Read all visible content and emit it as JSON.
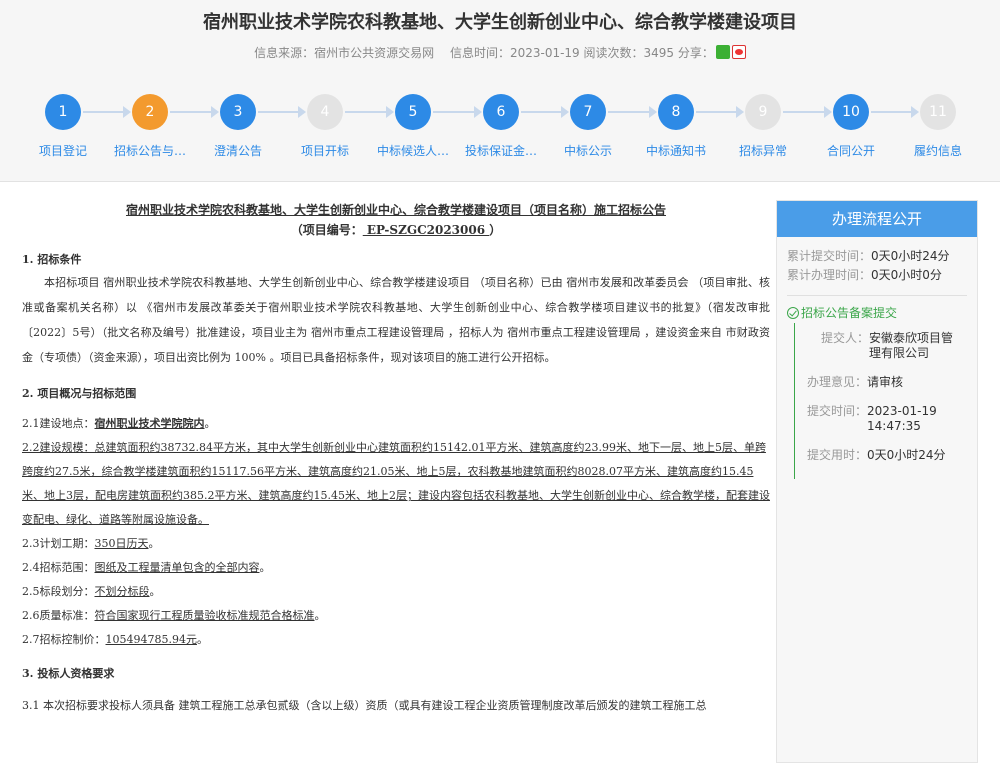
{
  "page": {
    "title": "宿州职业技术学院农科教基地、大学生创新创业中心、综合教学楼建设项目",
    "source_label": "信息来源：宿州市公共资源交易网",
    "time_label": "信息时间：2023-01-19 阅读次数：3495 分享："
  },
  "steps": [
    {
      "num": "1",
      "label": "项目登记",
      "state": "done"
    },
    {
      "num": "2",
      "label": "招标公告与…",
      "state": "current"
    },
    {
      "num": "3",
      "label": "澄清公告",
      "state": "done"
    },
    {
      "num": "4",
      "label": "项目开标",
      "state": "pending"
    },
    {
      "num": "5",
      "label": "中标候选人…",
      "state": "done"
    },
    {
      "num": "6",
      "label": "投标保证金…",
      "state": "done"
    },
    {
      "num": "7",
      "label": "中标公示",
      "state": "done"
    },
    {
      "num": "8",
      "label": "中标通知书",
      "state": "done"
    },
    {
      "num": "9",
      "label": "招标异常",
      "state": "pending"
    },
    {
      "num": "10",
      "label": "合同公开",
      "state": "done"
    },
    {
      "num": "11",
      "label": "履约信息",
      "state": "pending"
    }
  ],
  "doc": {
    "title_line1": "宿州职业技术学院农科教基地、大学生创新创业中心、综合教学楼建设项目（项目名称）施工招标公告",
    "title_line2_prefix": "（项目编号：",
    "title_line2_code": "    EP-SZGC2023006 ",
    "title_line2_suffix": "）",
    "sec1": "1. 招标条件",
    "sec1_para": "本招标项目 宿州职业技术学院农科教基地、大学生创新创业中心、综合教学楼建设项目 （项目名称）已由 宿州市发展和改革委员会 （项目审批、核准或备案机关名称）以 《宿州市发展改革委关于宿州职业技术学院农科教基地、大学生创新创业中心、综合教学楼项目建议书的批复》（宿发改审批〔2022〕5号）（批文名称及编号）批准建设，项目业主为 宿州市重点工程建设管理局 ，招标人为 宿州市重点工程建设管理局 ，建设资金来自 市财政资金（专项债）（资金来源），项目出资比例为 100% 。项目已具备招标条件，现对该项目的施工进行公开招标。",
    "sec2": "2. 项目概况与招标范围",
    "l21_prefix": "2.1建设地点：",
    "l21_value": "宿州职业技术学院院内",
    "l22": "2.2建设规模：总建筑面积约38732.84平方米，其中大学生创新创业中心建筑面积约15142.01平方米、建筑高度约23.99米、地下一层、地上5层、单跨跨度约27.5米，综合教学楼建筑面积约15117.56平方米、建筑高度约21.05米、地上5层，农科教基地建筑面积约8028.07平方米、建筑高度约15.45米、地上3层，配电房建筑面积约385.2平方米、建筑高度约15.45米、地上2层；建设内容包括农科教基地、大学生创新创业中心、综合教学楼，配套建设变配电、绿化、道路等附属设施设备。",
    "l23_prefix": "2.3计划工期：",
    "l23_value": "350日历天",
    "l24_prefix": "2.4招标范围：",
    "l24_value": "图纸及工程量清单包含的全部内容",
    "l25_prefix": "2.5标段划分：",
    "l25_value": "不划分标段",
    "l26_prefix": "2.6质量标准：",
    "l26_value": "符合国家现行工程质量验收标准规范合格标准",
    "l27_prefix": "2.7招标控制价：",
    "l27_value": "105494785.94元",
    "sec3": "3. 投标人资格要求",
    "l31": "3.1 本次招标要求投标人须具备 建筑工程施工总承包贰级（含以上级）资质（或具有建设工程企业资质管理制度改革后颁发的建筑工程施工总"
  },
  "sidebar": {
    "header": "办理流程公开",
    "stat1_label": "累计提交时间：",
    "stat1_value": "0天0小时24分",
    "stat2_label": "累计办理时间：",
    "stat2_value": "0天0小时0分",
    "node": "招标公告备案提交",
    "submitter_label": "提交人：",
    "submitter_value": "安徽泰欣项目管理有限公司",
    "opinion_label": "办理意见：",
    "opinion_value": "请审核",
    "time_label": "提交时间：",
    "time_value": "2023-01-19 14:47:35",
    "duration_label": "提交用时：",
    "duration_value": "0天0小时24分"
  },
  "colors": {
    "accent": "#2d8ae6",
    "current": "#f39a2e",
    "pending": "#e3e3e3",
    "ok": "#3ba64a"
  }
}
